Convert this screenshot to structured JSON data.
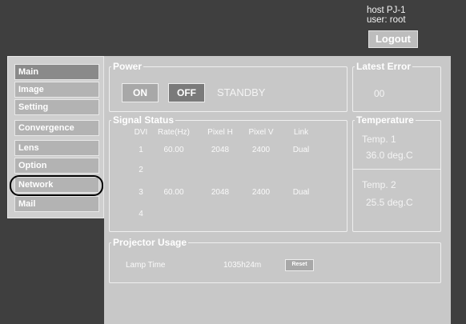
{
  "header": {
    "host": "host PJ-1",
    "user": "user: root",
    "logout_label": "Logout"
  },
  "sidebar": {
    "items": [
      {
        "label": "Main"
      },
      {
        "label": "Image"
      },
      {
        "label": "Setting"
      },
      {
        "label": "Convergence"
      },
      {
        "label": "Lens"
      },
      {
        "label": "Option"
      },
      {
        "label": "Network"
      },
      {
        "label": "Mail"
      }
    ],
    "selected": "Main",
    "highlighted": "Network"
  },
  "power": {
    "title": "Power",
    "on_label": "ON",
    "off_label": "OFF",
    "state": "STANDBY"
  },
  "latest_error": {
    "title": "Latest Error",
    "value": "00"
  },
  "signal_status": {
    "title": "Signal Status",
    "headers": [
      "DVI",
      "Rate(Hz)",
      "Pixel H",
      "Pixel V",
      "Link"
    ],
    "rows": [
      {
        "dvi": "1",
        "rate": "60.00",
        "pixel_h": "2048",
        "pixel_v": "2400",
        "link": "Dual"
      },
      {
        "dvi": "2",
        "rate": "",
        "pixel_h": "",
        "pixel_v": "",
        "link": ""
      },
      {
        "dvi": "3",
        "rate": "60.00",
        "pixel_h": "2048",
        "pixel_v": "2400",
        "link": "Dual"
      },
      {
        "dvi": "4",
        "rate": "",
        "pixel_h": "",
        "pixel_v": "",
        "link": ""
      }
    ]
  },
  "temperature": {
    "title": "Temperature",
    "sensors": [
      {
        "label": "Temp. 1",
        "value": "36.0 deg.C"
      },
      {
        "label": "Temp. 2",
        "value": "25.5 deg.C"
      }
    ]
  },
  "projector_usage": {
    "title": "Projector Usage",
    "lamp_label": "Lamp Time",
    "lamp_value": "1035h24m",
    "reset_label": "Reset"
  },
  "colors": {
    "background": "#3f3f3f",
    "panel": "#c8c8c8",
    "nav_button": "#b3b3b3",
    "nav_selected": "#8a8a8a",
    "off_button": "#7a7a7a",
    "text": "#ffffff"
  }
}
